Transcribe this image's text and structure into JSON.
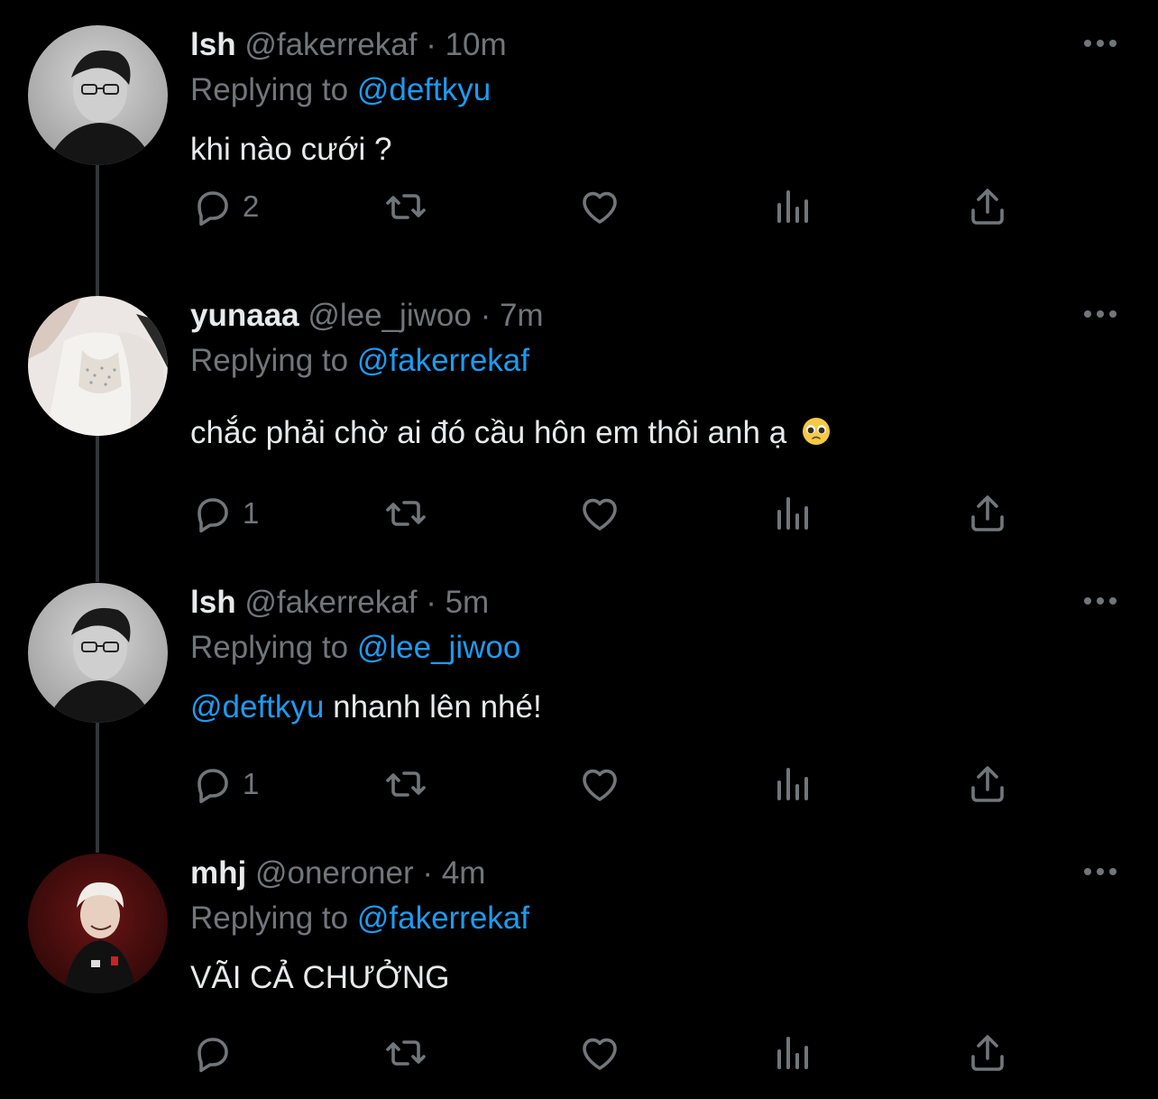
{
  "colors": {
    "background": "#000000",
    "text": "#e7e9ea",
    "muted": "#71767b",
    "accent": "#1d9bf0"
  },
  "tweets": [
    {
      "name": "lsh",
      "handle": "@fakerrekaf",
      "dot": "·",
      "time": "10m",
      "replying_prefix": "Replying to",
      "replying_to": "@deftkyu",
      "body_mention": "",
      "body_text": "khi nào cưới ?",
      "emoji": "",
      "reply_count": "2",
      "avatar_icon": "avatar-photo"
    },
    {
      "name": "yunaaa",
      "handle": "@lee_jiwoo",
      "dot": "·",
      "time": "7m",
      "replying_prefix": "Replying to",
      "replying_to": "@fakerrekaf",
      "body_mention": "",
      "body_text": "chắc phải chờ ai đó cầu hôn em thôi anh ạ",
      "emoji": "pleading-face-emoji",
      "reply_count": "1",
      "avatar_icon": "avatar-photo"
    },
    {
      "name": "lsh",
      "handle": "@fakerrekaf",
      "dot": "·",
      "time": "5m",
      "replying_prefix": "Replying to",
      "replying_to": "@lee_jiwoo",
      "body_mention": "@deftkyu",
      "body_text": "nhanh lên nhé!",
      "emoji": "",
      "reply_count": "1",
      "avatar_icon": "avatar-photo"
    },
    {
      "name": "mhj",
      "handle": "@oneroner",
      "dot": "·",
      "time": "4m",
      "replying_prefix": "Replying to",
      "replying_to": "@fakerrekaf",
      "body_mention": "",
      "body_text": "VÃI CẢ CHƯỞNG",
      "emoji": "",
      "reply_count": "",
      "avatar_icon": "avatar-photo"
    }
  ],
  "icons": [
    "more-options-icon",
    "reply-icon",
    "retweet-icon",
    "like-icon",
    "views-icon",
    "share-icon"
  ]
}
